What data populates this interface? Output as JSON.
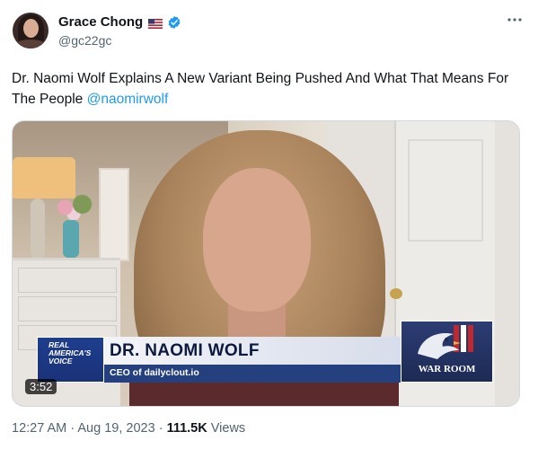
{
  "author": {
    "display_name": "Grace Chong",
    "handle": "@gc22gc",
    "flag_icon": "us-flag-icon",
    "verified_icon": "verified-badge-icon"
  },
  "tweet": {
    "text": "Dr. Naomi Wolf Explains A New Variant Being Pushed And What That Means For The People",
    "mention": "@naomirwolf"
  },
  "video": {
    "duration": "3:52",
    "lower_third": {
      "network_logo_line1": "REAL",
      "network_logo_line2": "AMERICA'S",
      "network_logo_line3": "VOICE",
      "guest_name": "DR. NAOMI WOLF",
      "guest_title": "CEO of dailyclout.io",
      "show_logo": "WAR ROOM"
    }
  },
  "meta": {
    "time": "12:27 AM",
    "separator": "·",
    "date": "Aug 19, 2023",
    "views_count": "111.5K",
    "views_label": "Views"
  },
  "colors": {
    "link": "#1d9bf0",
    "secondary_text": "#536471",
    "primary_text": "#0f1419"
  }
}
